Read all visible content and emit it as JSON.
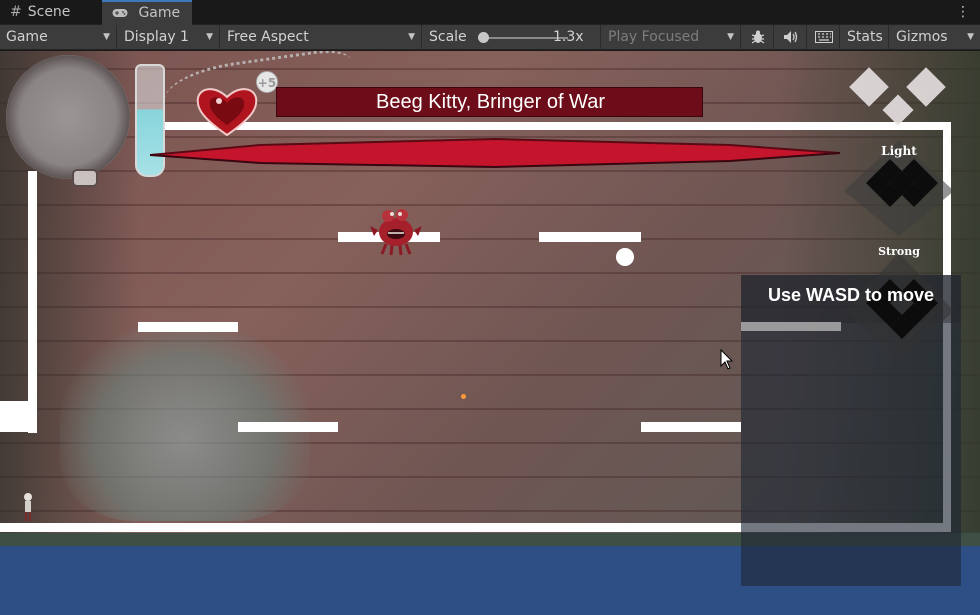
{
  "tabs": {
    "scene_label": "Scene",
    "game_label": "Game",
    "menu_glyph": "⋮"
  },
  "toolbar": {
    "view_mode": "Game",
    "display": "Display 1",
    "aspect": "Free Aspect",
    "scale_label": "Scale",
    "scale_value": "1.3x",
    "scale_fraction": 0.0,
    "play_mode": "Play Focused",
    "stats_label": "Stats",
    "gizmos_label": "Gizmos",
    "icons": [
      "bug-icon",
      "speaker-icon",
      "keyboard-icon"
    ]
  },
  "hud": {
    "boss_name": "Beeg Kitty, Bringer of War",
    "stack_badge": "+5",
    "element_light": "Light",
    "element_strong": "Strong"
  },
  "tooltip": {
    "text": "Use WASD to move"
  },
  "colors": {
    "accent_tab": "#3a79bb",
    "boss_plate": "#6d0d1a",
    "health": "#c4152c",
    "vial_fluid": "#88d4dc",
    "floor_blue": "#2e4f86"
  }
}
